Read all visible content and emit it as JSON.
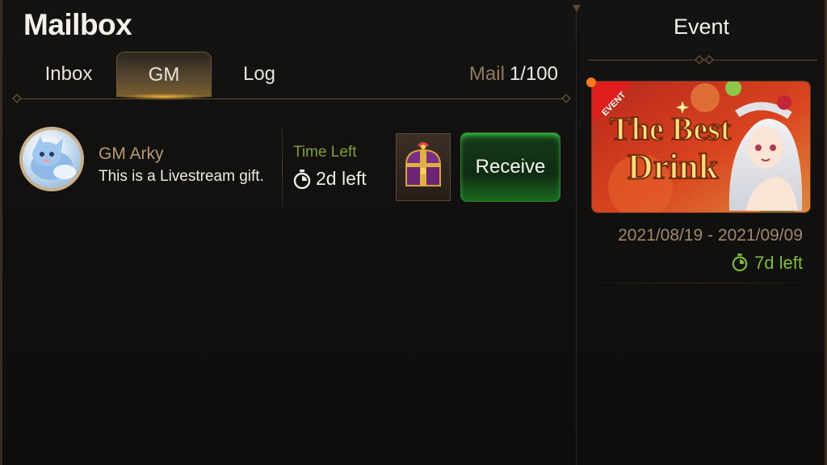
{
  "header": {
    "title": "Mailbox"
  },
  "tabs": [
    {
      "label": "Inbox"
    },
    {
      "label": "GM"
    },
    {
      "label": "Log"
    }
  ],
  "mail_count": {
    "label": "Mail",
    "value": "1/100"
  },
  "mails": [
    {
      "sender": "GM Arky",
      "message": "This is a Livestream gift.",
      "time_label": "Time Left",
      "time_value": "2d left",
      "reward_icon": "treasure-chest-icon",
      "action_label": "Receive"
    }
  ],
  "event_panel": {
    "title": "Event",
    "banner_badge": "EVENT",
    "banner_title_line1": "The Best",
    "banner_title_line2": "Drink",
    "dates": "2021/08/19 - 2021/09/09",
    "time_left": "7d left"
  },
  "colors": {
    "accent_gold": "#b69a6e",
    "time_green": "#7fa02e",
    "receive_green": "#1a6a20",
    "event_time_green": "#7fbd2f",
    "banner_red": "#c8231b"
  }
}
